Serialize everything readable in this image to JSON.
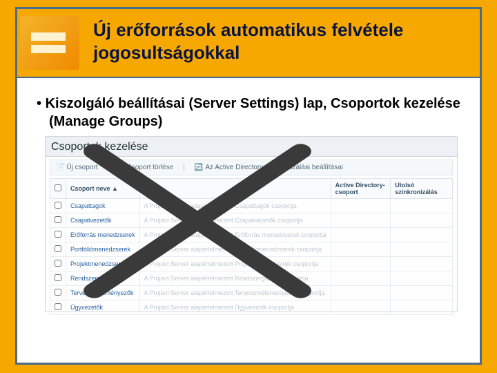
{
  "header": {
    "title": "Új erőforrások automatikus felvétele jogosultságokkal"
  },
  "bullet": {
    "text": "Kiszolgáló beállításai (Server Settings) lap, Csoportok kezelése (Manage Groups)"
  },
  "screenshot": {
    "title": "Csoportok kezelése",
    "toolbar": {
      "new": "Új csoport",
      "delete": "Csoport törlése",
      "sync": "Az Active Directory szinkronizálási beállításai"
    },
    "columns": {
      "name": "Csoport neve ▲",
      "desc": "Leírás",
      "ad": "Active Directory-csoport",
      "last": "Utolsó szinkronizálás"
    },
    "rows": [
      {
        "name": "Csapattagok",
        "desc": "A Project Server alapértelmezett Csapattagok csoportja"
      },
      {
        "name": "Csapatvezetők",
        "desc": "A Project Server alapértelmezett Csapatvezetők csoportja"
      },
      {
        "name": "Erőforrás menedzserek",
        "desc": "A Project Server alapértelmezett Erőforrás menedzserek csoportja"
      },
      {
        "name": "Portfóliómenedzserek",
        "desc": "A Project Server alapértelmezett Portfóliómenedzserek csoportja"
      },
      {
        "name": "Projektmenedzserek",
        "desc": "A Project Server alapértelmezett Projektmenedzserek csoportja"
      },
      {
        "name": "Rendszergazdák",
        "desc": "A Project Server alapértelmezett Rendszergazdák csoportja"
      },
      {
        "name": "Tervezetvéleményezők",
        "desc": "A Project Server alapértelmezett Tervezetvéleményezők csoportja"
      },
      {
        "name": "Ügyvezetők",
        "desc": "A Project Server alapértelmezett Ügyvezetők csoportja"
      }
    ]
  }
}
